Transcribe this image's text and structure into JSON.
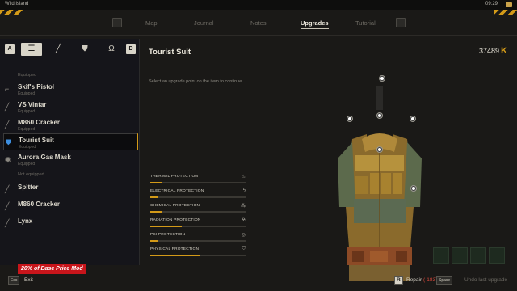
{
  "status_bar": {
    "location": "Wild Island",
    "time": "09:29"
  },
  "nav": {
    "tabs": [
      {
        "label": "Map",
        "active": false
      },
      {
        "label": "Journal",
        "active": false
      },
      {
        "label": "Notes",
        "active": false
      },
      {
        "label": "Upgrades",
        "active": true
      },
      {
        "label": "Tutorial",
        "active": false
      }
    ]
  },
  "categories": {
    "left_key": "A",
    "right_key": "D",
    "icons": [
      "list-icon",
      "rifle-icon",
      "armor-icon",
      "helmet-icon"
    ]
  },
  "inventory": {
    "equipped_header": "Equipped",
    "not_equipped_header": "Not equipped",
    "items": [
      {
        "name": "Skif's Pistol",
        "sub": "Equipped",
        "icon": "pistol-icon",
        "selected": false
      },
      {
        "name": "VS Vintar",
        "sub": "Equipped",
        "icon": "rifle-icon",
        "selected": false
      },
      {
        "name": "M860 Cracker",
        "sub": "Equipped",
        "icon": "shotgun-icon",
        "selected": false
      },
      {
        "name": "Tourist Suit",
        "sub": "Equipped",
        "icon": "suit-icon",
        "selected": true
      },
      {
        "name": "Aurora Gas Mask",
        "sub": "Equipped",
        "icon": "gasmask-icon",
        "selected": false
      },
      {
        "name": "Spitter",
        "sub": "",
        "icon": "rifle-icon",
        "selected": false
      },
      {
        "name": "M860 Cracker",
        "sub": "",
        "icon": "shotgun-icon",
        "selected": false
      },
      {
        "name": "Lynx",
        "sub": "",
        "icon": "sniper-icon",
        "selected": false
      }
    ]
  },
  "detail": {
    "title": "Tourist Suit",
    "money": "37489",
    "currency_symbol": "K",
    "hint": "Select an upgrade point on the item to continue",
    "protections": [
      {
        "label": "THERMAL PROTECTION",
        "value": 0.12,
        "icon": "flame-icon"
      },
      {
        "label": "ELECTRICAL PROTECTION",
        "value": 0.08,
        "icon": "electric-icon"
      },
      {
        "label": "CHEMICAL PROTECTION",
        "value": 0.12,
        "icon": "chemical-icon"
      },
      {
        "label": "RADIATION PROTECTION",
        "value": 0.33,
        "icon": "radiation-icon"
      },
      {
        "label": "PSI PROTECTION",
        "value": 0.08,
        "icon": "psi-icon"
      },
      {
        "label": "PHYSICAL PROTECTION",
        "value": 0.52,
        "icon": "shield-icon"
      }
    ]
  },
  "promo_badge": "20% of Base Price Mod",
  "bottom": {
    "exit_key": "Esc",
    "exit_label": "Exit",
    "repair_key": "R",
    "repair_label": "Repair",
    "repair_cost": "(-1837 K)",
    "undo_key": "Space",
    "undo_label": "Undo last upgrade"
  },
  "colors": {
    "accent": "#d39a18",
    "selected_icon": "#3d8fe0",
    "promo": "#c8151b",
    "negative": "#d9483b"
  }
}
